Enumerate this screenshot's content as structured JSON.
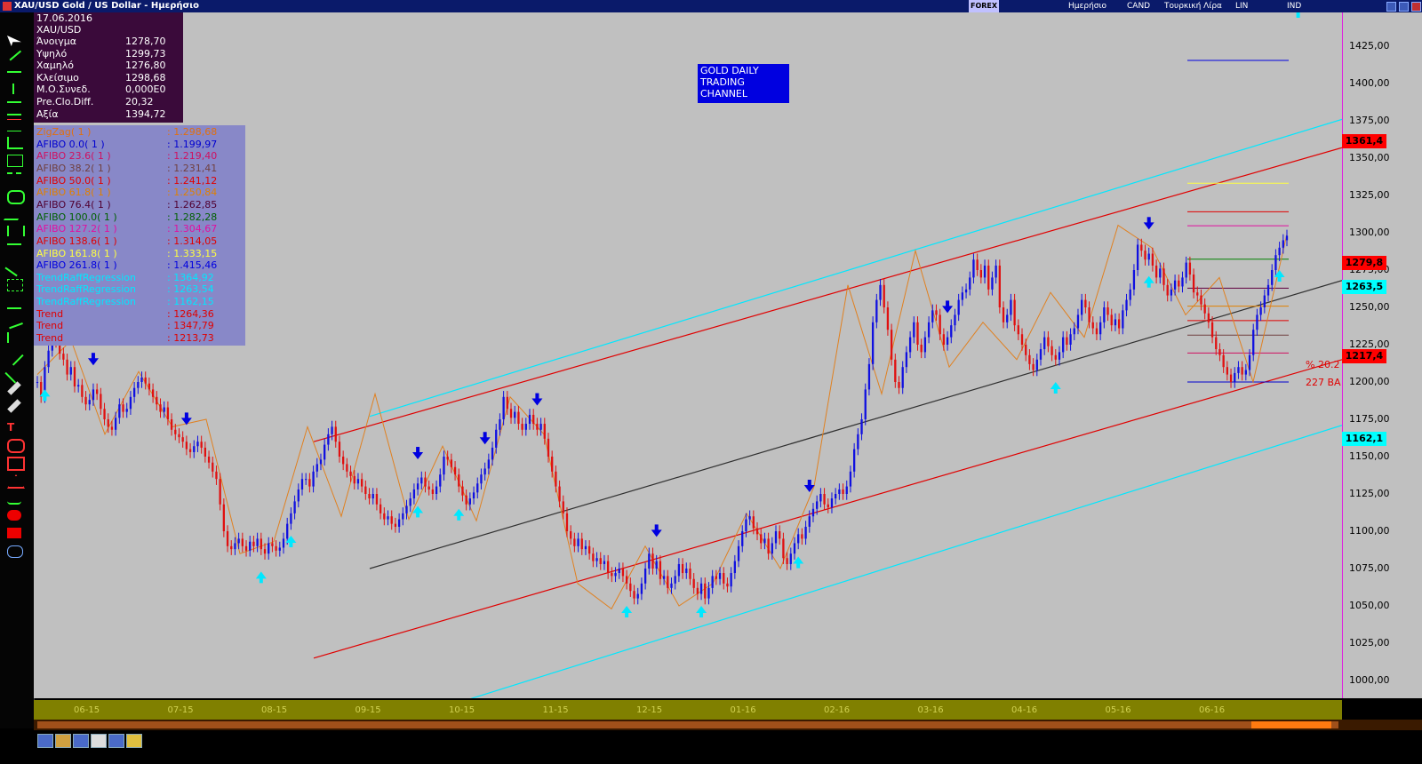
{
  "window": {
    "title": "XAU/USD Gold / US Dollar - Ημερήσιο",
    "toolbar_items": [
      "Ημερήσιο",
      "CAND",
      "Τουρκική Λίρα",
      "LIN",
      "IND"
    ],
    "logo_text": "FOREX"
  },
  "ohlc": {
    "date": "17.06.2016",
    "symbol": "XAU/USD",
    "rows": [
      {
        "label": "Άνοιγμα",
        "value": "1278,70"
      },
      {
        "label": "Υψηλό",
        "value": "1299,73"
      },
      {
        "label": "Χαμηλό",
        "value": "1276,80"
      },
      {
        "label": "Κλείσιμο",
        "value": "1298,68"
      },
      {
        "label": "Μ.Ο.Συνεδ.",
        "value": "0,000E0"
      },
      {
        "label": "Pre.Clo.Diff.",
        "value": "20,32"
      },
      {
        "label": "Αξία",
        "value": "1394,72"
      }
    ]
  },
  "legend": [
    {
      "label": "ZigZag( 1 )",
      "value": ": 1.298,68",
      "color": "#e07010"
    },
    {
      "label": "AFIBO 0.0( 1 )",
      "value": ": 1.199,97",
      "color": "#0000d0"
    },
    {
      "label": "AFIBO 23.6( 1 )",
      "value": ": 1.219,40",
      "color": "#d01060"
    },
    {
      "label": "AFIBO 38.2( 1 )",
      "value": ": 1.231,41",
      "color": "#704040"
    },
    {
      "label": "AFIBO 50.0( 1 )",
      "value": ": 1.241,12",
      "color": "#e00000"
    },
    {
      "label": "AFIBO 61.8( 1 )",
      "value": ": 1.250,84",
      "color": "#e08000"
    },
    {
      "label": "AFIBO 76.4( 1 )",
      "value": ": 1.262,85",
      "color": "#500030"
    },
    {
      "label": "AFIBO 100.0( 1 )",
      "value": ": 1.282,28",
      "color": "#006000"
    },
    {
      "label": "AFIBO 127.2( 1 )",
      "value": ": 1.304,67",
      "color": "#e010a0"
    },
    {
      "label": "AFIBO 138.6( 1 )",
      "value": ": 1.314,05",
      "color": "#e00000"
    },
    {
      "label": "AFIBO 161.8( 1 )",
      "value": ": 1.333,15",
      "color": "#ffff40"
    },
    {
      "label": "AFIBO 261.8( 1 )",
      "value": ": 1.415,46",
      "color": "#0000e0"
    },
    {
      "label": "TrendRaffRegression",
      "value": ": 1364,92",
      "color": "#00e8ff"
    },
    {
      "label": "TrendRaffRegression",
      "value": ": 1263,54",
      "color": "#00e8ff"
    },
    {
      "label": "TrendRaffRegression",
      "value": ": 1162,15",
      "color": "#00e8ff"
    },
    {
      "label": "Trend",
      "value": ": 1264,36",
      "color": "#e00000"
    },
    {
      "label": "Trend",
      "value": ": 1347,79",
      "color": "#e00000"
    },
    {
      "label": "Trend",
      "value": ": 1213,73",
      "color": "#e00000"
    }
  ],
  "note": {
    "line1": "GOLD DAILY",
    "line2": "TRADING",
    "line3": "CHANNEL"
  },
  "side_labels": {
    "pct": "% 20.2",
    "ba": "227 BA"
  },
  "chart_data": {
    "type": "candlestick",
    "ylim": [
      985,
      1440
    ],
    "y_ticks": [
      "1425,00",
      "1400,00",
      "1375,00",
      "1350,00",
      "1325,00",
      "1300,00",
      "1275,00",
      "1250,00",
      "1225,00",
      "1200,00",
      "1175,00",
      "1150,00",
      "1125,00",
      "1100,00",
      "1075,00",
      "1050,00",
      "1025,00",
      "1000,00"
    ],
    "y_tick_values": [
      1425,
      1400,
      1375,
      1350,
      1325,
      1300,
      1275,
      1250,
      1225,
      1200,
      1175,
      1150,
      1125,
      1100,
      1075,
      1050,
      1025,
      1000
    ],
    "x_ticks": [
      "06-15",
      "07-15",
      "08-15",
      "09-15",
      "10-15",
      "11-15",
      "12-15",
      "01-16",
      "02-16",
      "03-16",
      "04-16",
      "05-16",
      "06-16"
    ],
    "price_badges": [
      {
        "text": "1361,4",
        "value": 1361.4,
        "bg": "#ff0000",
        "fg": "#000000"
      },
      {
        "text": "1279,8",
        "value": 1279.8,
        "bg": "#ff0000",
        "fg": "#000000"
      },
      {
        "text": "1263,5",
        "value": 1263.5,
        "bg": "#00ffff",
        "fg": "#000000"
      },
      {
        "text": "1217,4",
        "value": 1217.4,
        "bg": "#ff0000",
        "fg": "#000000"
      },
      {
        "text": "1162,1",
        "value": 1162.1,
        "bg": "#00ffff",
        "fg": "#000000"
      }
    ],
    "regression_lines": [
      {
        "name": "upper",
        "start": 1177,
        "end": 1376,
        "color": "#00e8ff"
      },
      {
        "name": "middle",
        "start": 1075,
        "end": 1268,
        "color": "#303030"
      },
      {
        "name": "lower",
        "start": 980,
        "end": 1171,
        "color": "#00e8ff"
      }
    ],
    "trend_lines": [
      {
        "start": 1160,
        "end": 1357,
        "color": "#e00000"
      },
      {
        "start": 1015,
        "end": 1215,
        "color": "#e00000"
      }
    ],
    "fib_levels": [
      {
        "value": 1415.46,
        "color": "#0000e0"
      },
      {
        "value": 1333.15,
        "color": "#ffff40"
      },
      {
        "value": 1314.05,
        "color": "#e00000"
      },
      {
        "value": 1304.67,
        "color": "#e010a0"
      },
      {
        "value": 1282.28,
        "color": "#008000"
      },
      {
        "value": 1262.85,
        "color": "#600040"
      },
      {
        "value": 1250.84,
        "color": "#e08000"
      },
      {
        "value": 1241.12,
        "color": "#e00000"
      },
      {
        "value": 1231.41,
        "color": "#704040"
      },
      {
        "value": 1219.4,
        "color": "#d01060"
      },
      {
        "value": 1199.97,
        "color": "#0000d0"
      }
    ],
    "zigzag": [
      1205,
      1228,
      1165,
      1207,
      1170,
      1175,
      1085,
      1093,
      1170,
      1110,
      1192,
      1108,
      1157,
      1107,
      1190,
      1165,
      1065,
      1048,
      1090,
      1050,
      1065,
      1112,
      1075,
      1130,
      1265,
      1192,
      1288,
      1210,
      1240,
      1215,
      1260,
      1230,
      1305,
      1290,
      1245,
      1270,
      1200,
      1299
    ],
    "candles": [
      1200,
      1190,
      1210,
      1221,
      1228,
      1227,
      1219,
      1215,
      1205,
      1210,
      1197,
      1198,
      1190,
      1185,
      1188,
      1195,
      1192,
      1182,
      1175,
      1170,
      1168,
      1176,
      1185,
      1180,
      1182,
      1190,
      1196,
      1200,
      1203,
      1199,
      1195,
      1190,
      1185,
      1180,
      1183,
      1175,
      1168,
      1165,
      1163,
      1160,
      1155,
      1153,
      1157,
      1160,
      1156,
      1150,
      1146,
      1140,
      1135,
      1118,
      1100,
      1090,
      1088,
      1092,
      1095,
      1090,
      1087,
      1093,
      1090,
      1095,
      1088,
      1085,
      1092,
      1090,
      1087,
      1089,
      1095,
      1105,
      1112,
      1120,
      1128,
      1135,
      1135,
      1130,
      1140,
      1145,
      1148,
      1158,
      1165,
      1170,
      1160,
      1150,
      1145,
      1140,
      1137,
      1132,
      1135,
      1130,
      1125,
      1122,
      1125,
      1118,
      1112,
      1108,
      1110,
      1105,
      1103,
      1108,
      1112,
      1117,
      1122,
      1128,
      1132,
      1136,
      1130,
      1128,
      1125,
      1130,
      1138,
      1150,
      1148,
      1143,
      1138,
      1130,
      1124,
      1118,
      1122,
      1126,
      1132,
      1138,
      1142,
      1148,
      1156,
      1168,
      1175,
      1190,
      1182,
      1176,
      1180,
      1172,
      1168,
      1172,
      1178,
      1172,
      1168,
      1172,
      1162,
      1150,
      1140,
      1130,
      1120,
      1112,
      1100,
      1095,
      1090,
      1095,
      1088,
      1090,
      1085,
      1080,
      1082,
      1078,
      1080,
      1072,
      1070,
      1072,
      1075,
      1070,
      1065,
      1060,
      1055,
      1058,
      1065,
      1075,
      1085,
      1075,
      1080,
      1068,
      1070,
      1062,
      1065,
      1070,
      1078,
      1072,
      1075,
      1068,
      1062,
      1058,
      1065,
      1055,
      1062,
      1070,
      1068,
      1072,
      1065,
      1063,
      1072,
      1080,
      1090,
      1100,
      1108,
      1110,
      1102,
      1098,
      1092,
      1095,
      1085,
      1092,
      1100,
      1095,
      1082,
      1078,
      1085,
      1092,
      1098,
      1095,
      1103,
      1110,
      1115,
      1120,
      1125,
      1118,
      1116,
      1122,
      1125,
      1128,
      1125,
      1130,
      1140,
      1155,
      1165,
      1175,
      1195,
      1212,
      1240,
      1255,
      1265,
      1250,
      1235,
      1215,
      1200,
      1196,
      1210,
      1220,
      1230,
      1240,
      1225,
      1220,
      1230,
      1240,
      1248,
      1245,
      1232,
      1225,
      1230,
      1238,
      1245,
      1255,
      1260,
      1262,
      1270,
      1282,
      1275,
      1270,
      1278,
      1262,
      1270,
      1278,
      1250,
      1240,
      1245,
      1255,
      1238,
      1232,
      1225,
      1218,
      1212,
      1208,
      1215,
      1222,
      1230,
      1224,
      1218,
      1215,
      1220,
      1230,
      1225,
      1232,
      1236,
      1245,
      1255,
      1250,
      1240,
      1236,
      1232,
      1240,
      1250,
      1245,
      1238,
      1242,
      1236,
      1248,
      1255,
      1262,
      1275,
      1292,
      1288,
      1282,
      1286,
      1278,
      1270,
      1276,
      1265,
      1258,
      1262,
      1268,
      1264,
      1270,
      1280,
      1272,
      1260,
      1258,
      1252,
      1246,
      1240,
      1230,
      1222,
      1218,
      1210,
      1205,
      1200,
      1206,
      1210,
      1205,
      1208,
      1218,
      1235,
      1245,
      1250,
      1258,
      1265,
      1275,
      1285,
      1290,
      1295,
      1298
    ],
    "arrows_down": [
      0.038,
      0.105,
      0.26,
      0.402,
      0.46,
      0.528,
      0.745,
      0.842,
      0.975
    ],
    "arrows_up": [
      0.008,
      0.085,
      0.22,
      0.312,
      0.355,
      0.49,
      0.532,
      0.748,
      0.794,
      0.865,
      0.925,
      0.95
    ],
    "arrows_up_idx": [
      2,
      60,
      68,
      102,
      113,
      158,
      178,
      204,
      273,
      298,
      333,
      338
    ],
    "arrows_down_idx": [
      15,
      40,
      102,
      120,
      134,
      166,
      207,
      244,
      298
    ]
  }
}
